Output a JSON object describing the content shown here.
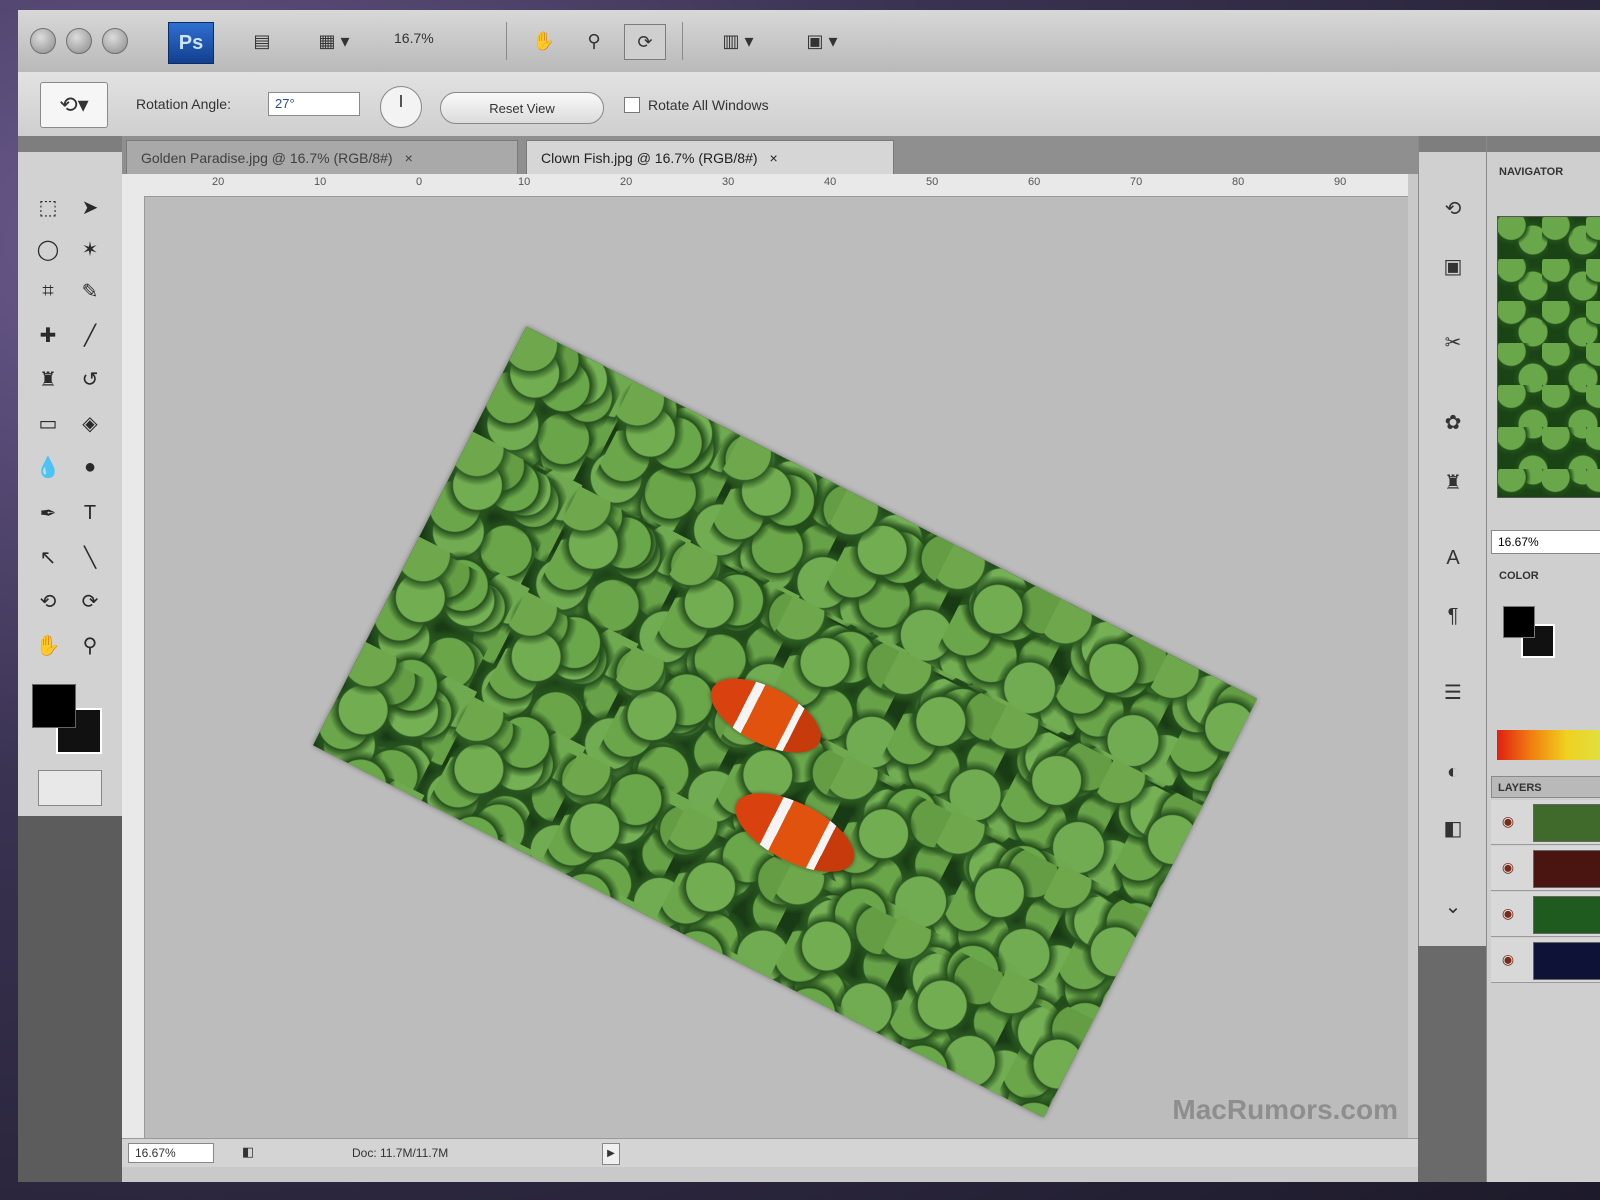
{
  "window": {
    "zoom_dropdown": "16.7%"
  },
  "options_bar": {
    "rotation_label": "Rotation Angle:",
    "rotation_value": "27°",
    "reset_view_label": "Reset View",
    "rotate_all_label": "Rotate All Windows"
  },
  "tabs": [
    {
      "label": "Golden Paradise.jpg @ 16.7% (RGB/8#)"
    },
    {
      "label": "Clown Fish.jpg @ 16.7% (RGB/8#)"
    }
  ],
  "ruler": {
    "top_numbers": [
      "20",
      "10",
      "0",
      "10",
      "20",
      "30",
      "40",
      "50",
      "60",
      "70",
      "80",
      "90"
    ]
  },
  "canvas": {
    "watermark": "MacRumors.com"
  },
  "status_bar": {
    "zoom": "16.67%",
    "doc_size": "Doc: 11.7M/11.7M"
  },
  "panels": {
    "navigator_title": "NAVIGATOR",
    "navigator_zoom": "16.67%",
    "color_title": "COLOR",
    "layers_title": "LAYERS"
  },
  "colors": {
    "accent": "#1f5bb8",
    "canvas_bg": "#bdbcbd"
  }
}
